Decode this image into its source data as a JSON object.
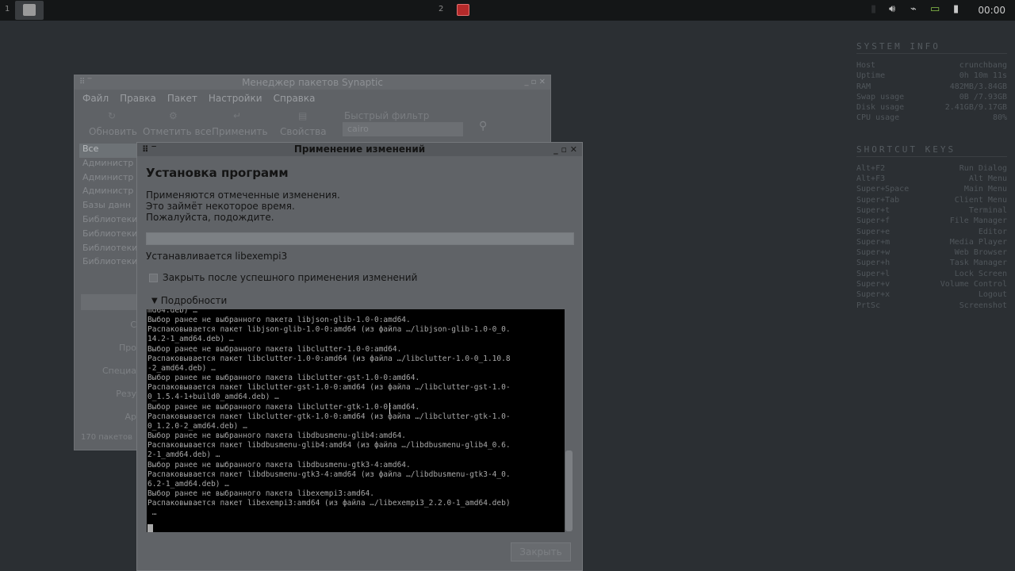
{
  "panel": {
    "ws1_num": "1",
    "ws2_num": "2",
    "clock": "00:00"
  },
  "conky": {
    "system_header": "SYSTEM INFO",
    "system_rows": [
      {
        "key": "Host",
        "value": "crunchbang"
      },
      {
        "key": "Uptime",
        "value": "0h 10m 11s"
      },
      {
        "key": "RAM",
        "value": "482MB/3.84GB"
      },
      {
        "key": "Swap usage",
        "value": "0B /7.93GB"
      },
      {
        "key": "Disk usage",
        "value": "2.41GB/9.17GB"
      },
      {
        "key": "CPU usage",
        "value": "80%"
      }
    ],
    "shortcut_header": "SHORTCUT KEYS",
    "shortcut_rows": [
      {
        "key": "Alt+F2",
        "value": "Run Dialog"
      },
      {
        "key": "Alt+F3",
        "value": "Alt Menu"
      },
      {
        "key": "Super+Space",
        "value": "Main Menu"
      },
      {
        "key": "Super+Tab",
        "value": "Client Menu"
      },
      {
        "key": "Super+t",
        "value": "Terminal"
      },
      {
        "key": "Super+f",
        "value": "File Manager"
      },
      {
        "key": "Super+e",
        "value": "Editor"
      },
      {
        "key": "Super+m",
        "value": "Media Player"
      },
      {
        "key": "Super+w",
        "value": "Web Browser"
      },
      {
        "key": "Super+h",
        "value": "Task Manager"
      },
      {
        "key": "Super+l",
        "value": "Lock Screen"
      },
      {
        "key": "Super+v",
        "value": "Volume Control"
      },
      {
        "key": "Super+x",
        "value": "Logout"
      },
      {
        "key": "PrtSc",
        "value": "Screenshot"
      }
    ]
  },
  "synaptic": {
    "title": "Менеджер пакетов Synaptic",
    "menu": [
      "Файл",
      "Правка",
      "Пакет",
      "Настройки",
      "Справка"
    ],
    "toolbar": {
      "reload": "Обновить",
      "mark_all": "Отметить все",
      "apply": "Применить",
      "properties": "Свойства"
    },
    "quick_filter_label": "Быстрый фильтр",
    "quick_filter_value": "cairo",
    "categories": [
      "Все",
      "Администр",
      "Администр",
      "Администр",
      "Базы данн",
      "Библиотеки",
      "Библиотеки",
      "Библиотеки",
      "Библиотеки"
    ],
    "side_buttons": [
      "С",
      "Про",
      "Специа",
      "Резу",
      "Ар"
    ],
    "status": "170 пакетов"
  },
  "dialog": {
    "title": "Применение изменений",
    "heading": "Установка программ",
    "description": "Применяются отмеченные изменения. Это займёт некоторое время. Пожалуйста, подождите.",
    "progress": 1.0,
    "status": "Устанавливается libexempi3",
    "close_on_success": "Закрыть после успешного применения изменений",
    "details": "Подробности",
    "terminal_lines": [
      "md64.deb) …",
      "Выбор ранее не выбранного пакета libjson-glib-1.0-0:amd64.",
      "Распаковывается пакет libjson-glib-1.0-0:amd64 (из файла …/libjson-glib-1.0-0_0.",
      "14.2-1_amd64.deb) …",
      "Выбор ранее не выбранного пакета libclutter-1.0-0:amd64.",
      "Распаковывается пакет libclutter-1.0-0:amd64 (из файла …/libclutter-1.0-0_1.10.8",
      "-2_amd64.deb) …",
      "Выбор ранее не выбранного пакета libclutter-gst-1.0-0:amd64.",
      "Распаковывается пакет libclutter-gst-1.0-0:amd64 (из файла …/libclutter-gst-1.0-",
      "0_1.5.4-1+build0_amd64.deb) …",
      "Выбор ранее не выбранного пакета libclutter-gtk-1.0-0:amd64.",
      "Распаковывается пакет libclutter-gtk-1.0-0:amd64 (из файла …/libclutter-gtk-1.0-",
      "0_1.2.0-2_amd64.deb) …",
      "Выбор ранее не выбранного пакета libdbusmenu-glib4:amd64.",
      "Распаковывается пакет libdbusmenu-glib4:amd64 (из файла …/libdbusmenu-glib4_0.6.",
      "2-1_amd64.deb) …",
      "Выбор ранее не выбранного пакета libdbusmenu-gtk3-4:amd64.",
      "Распаковывается пакет libdbusmenu-gtk3-4:amd64 (из файла …/libdbusmenu-gtk3-4_0.",
      "6.2-1_amd64.deb) …",
      "Выбор ранее не выбранного пакета libexempi3:amd64.",
      "Распаковывается пакет libexempi3:amd64 (из файла …/libexempi3_2.2.0-1_amd64.deb)",
      " …"
    ],
    "close_button": "Закрыть"
  }
}
